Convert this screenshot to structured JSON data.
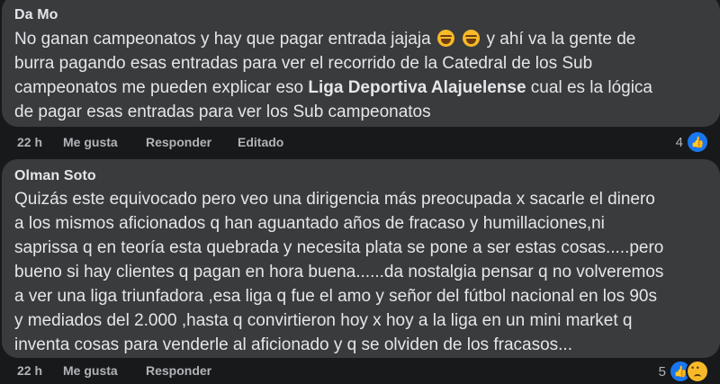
{
  "comments": [
    {
      "author": "Da Mo",
      "text_part1": "No ganan campeonatos y hay que pagar entrada jajaja",
      "text_part2": " y ahí va la gente de\nburra pagando esas entradas para ver el recorrido de la Catedral de los Sub\ncampeonatos me pueden explicar eso ",
      "text_bold": "Liga Deportiva Alajuelense",
      "text_part3": " cual es la lógica\nde pagar esas entradas para ver los Sub campeonatos",
      "emoji": [
        "laughing-tears-emoji",
        "laughing-tears-emoji"
      ],
      "time": "22 h",
      "like": "Me gusta",
      "reply": "Responder",
      "edited": "Editado",
      "reaction_count": "4",
      "reaction_icons": [
        "like-icon"
      ]
    },
    {
      "author": "Olman Soto",
      "text": "Quizás este equivocado pero veo una dirigencia más preocupada x sacarle el dinero\na los mismos aficionados q han aguantado años de fracaso y humillaciones,ni\nsaprissa q en teoría esta quebrada y necesita plata se pone a ser estas cosas.....pero\nbueno si hay clientes q pagan en hora buena......da nostalgia pensar q no volveremos\na ver una liga triunfadora ,esa liga q fue el amo y señor del fútbol nacional en los 90s\ny mediados del 2.000 ,hasta q convirtieron hoy x hoy a la liga en un mini market q\ninventa cosas para venderle al aficionado y q se olviden de los fracasos...",
      "time": "22 h",
      "like": "Me gusta",
      "reply": "Responder",
      "reaction_count": "5",
      "reaction_icons": [
        "like-icon",
        "sad-icon"
      ]
    }
  ],
  "colors": {
    "background": "#18191a",
    "bubble": "#3a3b3c",
    "text": "#e4e6eb",
    "meta": "#b0b3b8",
    "like_blue": "#1877f2"
  }
}
